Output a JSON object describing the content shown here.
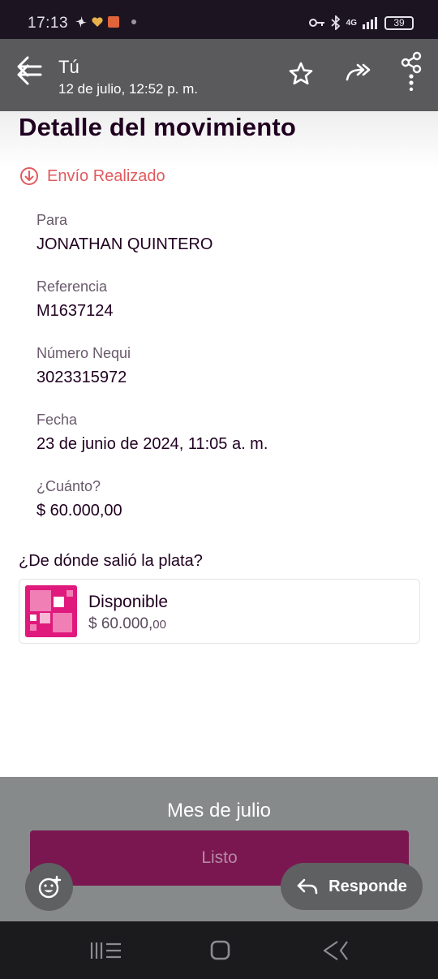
{
  "status_bar": {
    "time": "17:13",
    "network": "4G",
    "battery": "39"
  },
  "header": {
    "title": "Tú",
    "subtitle": "12 de julio, 12:52 p. m."
  },
  "detail": {
    "page_title": "Detalle del movimiento",
    "status": "Envío Realizado",
    "fields": [
      {
        "label": "Para",
        "value": "JONATHAN QUINTERO"
      },
      {
        "label": "Referencia",
        "value": "M1637124"
      },
      {
        "label": "Número Nequi",
        "value": "3023315972"
      },
      {
        "label": "Fecha",
        "value": "23 de junio de 2024, 11:05 a. m."
      },
      {
        "label": "¿Cuánto?",
        "value": "$ 60.000,00"
      }
    ],
    "source_title": "¿De dónde salió la plata?",
    "account": {
      "name": "Disponible",
      "amount_main": "$ 60.000,",
      "amount_cents": "00"
    }
  },
  "overlay": {
    "caption": "Mes de julio",
    "done_label": "Listo",
    "reply_label": "Responde"
  },
  "colors": {
    "brand_magenta": "#e0197c",
    "button_purple": "#7a1750",
    "status_red": "#e25a5e"
  }
}
